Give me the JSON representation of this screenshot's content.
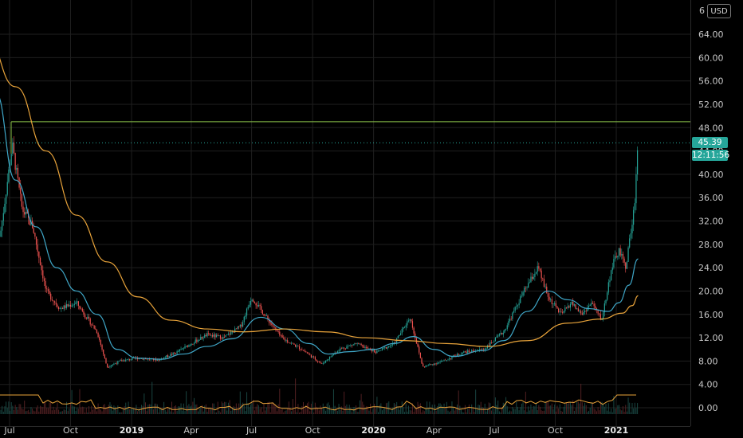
{
  "header": {
    "currency_label": "USD",
    "top_partial_label": "6"
  },
  "price_tag": {
    "price": "45.39",
    "countdown": "12:11:56"
  },
  "colors": {
    "background": "#000000",
    "up_candle": "#26a69a",
    "down_candle": "#ef5350",
    "ma_short": "#3fa7c8",
    "ma_long": "#e8a33a",
    "resistance_line": "#8bc34a",
    "volume_ma": "#e8a33a"
  },
  "chart_data": {
    "type": "candlestick",
    "y_ticks": [
      "64.00",
      "60.00",
      "56.00",
      "52.00",
      "48.00",
      "44.00",
      "40.00",
      "36.00",
      "32.00",
      "28.00",
      "24.00",
      "20.00",
      "16.00",
      "12.00",
      "8.00",
      "4.00",
      "0.00"
    ],
    "x_ticks": [
      {
        "label": "Jul",
        "bold": false
      },
      {
        "label": "Oct",
        "bold": false
      },
      {
        "label": "2019",
        "bold": true
      },
      {
        "label": "Apr",
        "bold": false
      },
      {
        "label": "Jul",
        "bold": false
      },
      {
        "label": "Oct",
        "bold": false
      },
      {
        "label": "2020",
        "bold": true
      },
      {
        "label": "Apr",
        "bold": false
      },
      {
        "label": "Jul",
        "bold": false
      },
      {
        "label": "Oct",
        "bold": false
      },
      {
        "label": "2021",
        "bold": true
      }
    ],
    "ylim": [
      0,
      66
    ],
    "grid": true,
    "horizontal_line": 49,
    "last_price": 45.39,
    "close_path": [
      {
        "t": "2018-06-15",
        "v": 28
      },
      {
        "t": "2018-07-05",
        "v": 45
      },
      {
        "t": "2018-07-20",
        "v": 34
      },
      {
        "t": "2018-08-05",
        "v": 31
      },
      {
        "t": "2018-08-25",
        "v": 20
      },
      {
        "t": "2018-09-15",
        "v": 17
      },
      {
        "t": "2018-10-10",
        "v": 18
      },
      {
        "t": "2018-10-25",
        "v": 15.5
      },
      {
        "t": "2018-11-10",
        "v": 13
      },
      {
        "t": "2018-11-25",
        "v": 7
      },
      {
        "t": "2018-12-15",
        "v": 8
      },
      {
        "t": "2019-01-10",
        "v": 8.5
      },
      {
        "t": "2019-02-10",
        "v": 8.2
      },
      {
        "t": "2019-03-10",
        "v": 9.5
      },
      {
        "t": "2019-04-01",
        "v": 11
      },
      {
        "t": "2019-04-25",
        "v": 12.5
      },
      {
        "t": "2019-05-20",
        "v": 12
      },
      {
        "t": "2019-06-15",
        "v": 14
      },
      {
        "t": "2019-07-01",
        "v": 19
      },
      {
        "t": "2019-07-20",
        "v": 16
      },
      {
        "t": "2019-08-15",
        "v": 12
      },
      {
        "t": "2019-09-15",
        "v": 10
      },
      {
        "t": "2019-10-15",
        "v": 7.5
      },
      {
        "t": "2019-11-10",
        "v": 10
      },
      {
        "t": "2019-12-05",
        "v": 11
      },
      {
        "t": "2020-01-05",
        "v": 9.5
      },
      {
        "t": "2020-02-01",
        "v": 11
      },
      {
        "t": "2020-02-25",
        "v": 15.5
      },
      {
        "t": "2020-03-15",
        "v": 7
      },
      {
        "t": "2020-04-15",
        "v": 8
      },
      {
        "t": "2020-05-15",
        "v": 9.5
      },
      {
        "t": "2020-06-15",
        "v": 10
      },
      {
        "t": "2020-07-15",
        "v": 13
      },
      {
        "t": "2020-08-15",
        "v": 20
      },
      {
        "t": "2020-09-05",
        "v": 24
      },
      {
        "t": "2020-09-20",
        "v": 19
      },
      {
        "t": "2020-10-10",
        "v": 16
      },
      {
        "t": "2020-10-25",
        "v": 18
      },
      {
        "t": "2020-11-10",
        "v": 16
      },
      {
        "t": "2020-11-25",
        "v": 18
      },
      {
        "t": "2020-12-10",
        "v": 15
      },
      {
        "t": "2020-12-25",
        "v": 24
      },
      {
        "t": "2021-01-05",
        "v": 27
      },
      {
        "t": "2021-01-15",
        "v": 24
      },
      {
        "t": "2021-01-28",
        "v": 34
      },
      {
        "t": "2021-02-03",
        "v": 46
      }
    ],
    "series": [
      {
        "id": "ma_short",
        "points": [
          {
            "t": "2018-06-10",
            "v": 54
          },
          {
            "t": "2018-07-10",
            "v": 39
          },
          {
            "t": "2018-08-10",
            "v": 31
          },
          {
            "t": "2018-09-10",
            "v": 24
          },
          {
            "t": "2018-10-10",
            "v": 20
          },
          {
            "t": "2018-11-10",
            "v": 16
          },
          {
            "t": "2018-12-10",
            "v": 10
          },
          {
            "t": "2019-01-10",
            "v": 8.5
          },
          {
            "t": "2019-02-15",
            "v": 8.3
          },
          {
            "t": "2019-03-20",
            "v": 9.2
          },
          {
            "t": "2019-04-25",
            "v": 10.5
          },
          {
            "t": "2019-06-01",
            "v": 11.8
          },
          {
            "t": "2019-07-15",
            "v": 15.5
          },
          {
            "t": "2019-08-20",
            "v": 13.5
          },
          {
            "t": "2019-09-25",
            "v": 11
          },
          {
            "t": "2019-10-25",
            "v": 9.2
          },
          {
            "t": "2019-11-25",
            "v": 9.6
          },
          {
            "t": "2020-01-01",
            "v": 10
          },
          {
            "t": "2020-02-01",
            "v": 11
          },
          {
            "t": "2020-03-01",
            "v": 12.2
          },
          {
            "t": "2020-04-01",
            "v": 10
          },
          {
            "t": "2020-05-01",
            "v": 8.8
          },
          {
            "t": "2020-06-15",
            "v": 9.8
          },
          {
            "t": "2020-07-15",
            "v": 11.5
          },
          {
            "t": "2020-08-20",
            "v": 16.5
          },
          {
            "t": "2020-09-20",
            "v": 20
          },
          {
            "t": "2020-10-20",
            "v": 18.5
          },
          {
            "t": "2020-11-20",
            "v": 17
          },
          {
            "t": "2020-12-20",
            "v": 16.5
          },
          {
            "t": "2021-01-05",
            "v": 18
          },
          {
            "t": "2021-01-20",
            "v": 21
          },
          {
            "t": "2021-02-03",
            "v": 25.5
          }
        ]
      },
      {
        "id": "ma_long",
        "points": [
          {
            "t": "2018-05-25",
            "v": 64
          },
          {
            "t": "2018-07-10",
            "v": 55
          },
          {
            "t": "2018-08-25",
            "v": 44
          },
          {
            "t": "2018-10-10",
            "v": 33
          },
          {
            "t": "2018-11-25",
            "v": 25
          },
          {
            "t": "2019-01-10",
            "v": 19
          },
          {
            "t": "2019-03-01",
            "v": 15
          },
          {
            "t": "2019-04-25",
            "v": 13.5
          },
          {
            "t": "2019-06-20",
            "v": 13
          },
          {
            "t": "2019-08-20",
            "v": 13.5
          },
          {
            "t": "2019-10-20",
            "v": 13
          },
          {
            "t": "2019-12-20",
            "v": 12
          },
          {
            "t": "2020-02-20",
            "v": 11.5
          },
          {
            "t": "2020-04-20",
            "v": 11
          },
          {
            "t": "2020-06-20",
            "v": 10.5
          },
          {
            "t": "2020-08-20",
            "v": 11.5
          },
          {
            "t": "2020-10-20",
            "v": 14.5
          },
          {
            "t": "2020-12-10",
            "v": 15.2
          },
          {
            "t": "2021-01-10",
            "v": 16.2
          },
          {
            "t": "2021-01-25",
            "v": 17.5
          },
          {
            "t": "2021-02-03",
            "v": 19.2
          }
        ]
      }
    ]
  }
}
